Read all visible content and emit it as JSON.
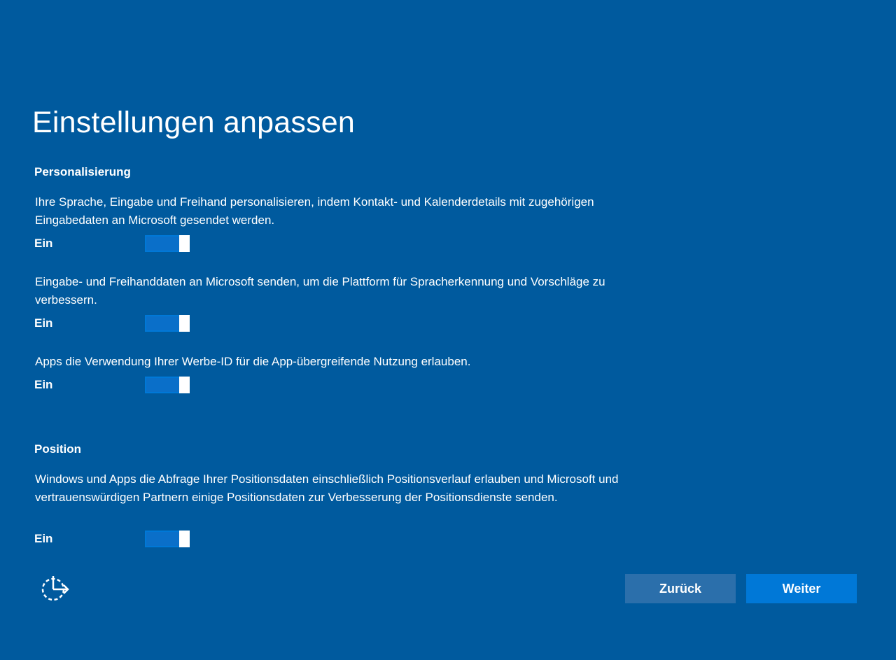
{
  "page": {
    "title": "Einstellungen anpassen"
  },
  "personalization": {
    "heading": "Personalisierung",
    "settings": [
      {
        "description": "Ihre Sprache, Eingabe und Freihand personalisieren, indem Kontakt- und Kalenderdetails mit zugehörigen Eingabedaten an Microsoft gesendet werden.",
        "state_label": "Ein",
        "enabled": true
      },
      {
        "description": "Eingabe- und Freihanddaten an Microsoft senden, um die Plattform für Spracherkennung und Vorschläge zu verbessern.",
        "state_label": "Ein",
        "enabled": true
      },
      {
        "description": "Apps die Verwendung Ihrer Werbe-ID für die App-übergreifende Nutzung erlauben.",
        "state_label": "Ein",
        "enabled": true
      }
    ]
  },
  "location": {
    "heading": "Position",
    "settings": [
      {
        "description": "Windows und Apps die Abfrage Ihrer Positionsdaten einschließlich Positionsverlauf erlauben und Microsoft und vertrauenswürdigen Partnern einige Positionsdaten zur Verbesserung der Positionsdienste senden.",
        "state_label": "Ein",
        "enabled": true
      }
    ]
  },
  "footer": {
    "accessibility_icon": "ease-of-access-icon",
    "back_label": "Zurück",
    "next_label": "Weiter"
  },
  "colors": {
    "background": "#005a9e",
    "accent": "#0078d7",
    "back_button": "#2b6fab"
  }
}
